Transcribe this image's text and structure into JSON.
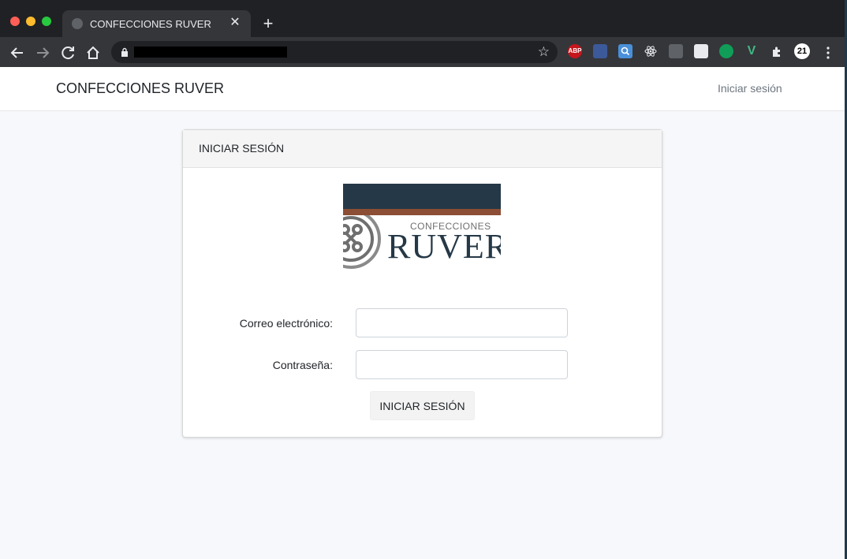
{
  "browser": {
    "tab_title": "CONFECCIONES RUVER",
    "tab_close": "✕",
    "new_tab": "+",
    "ext_abp": "ABP",
    "ext_badge": "21"
  },
  "colors": {
    "accent_dark": "#253847",
    "accent_brown": "#8c4e34"
  },
  "navbar": {
    "brand": "CONFECCIONES RUVER",
    "login_link": "Iniciar sesión"
  },
  "card": {
    "header": "INICIAR SESIÓN",
    "logo": {
      "small_text": "CONFECCIONES",
      "big_text": "RUVER"
    },
    "form": {
      "email_label": "Correo electrónico:",
      "email_value": "",
      "password_label": "Contraseña:",
      "password_value": "",
      "submit_label": "INICIAR SESIÓN"
    }
  },
  "icons": [
    "back-icon",
    "forward-icon",
    "reload-icon",
    "home-icon",
    "lock-icon",
    "star-icon",
    "extensions-icon",
    "menu-icon",
    "button-logo-icon"
  ]
}
